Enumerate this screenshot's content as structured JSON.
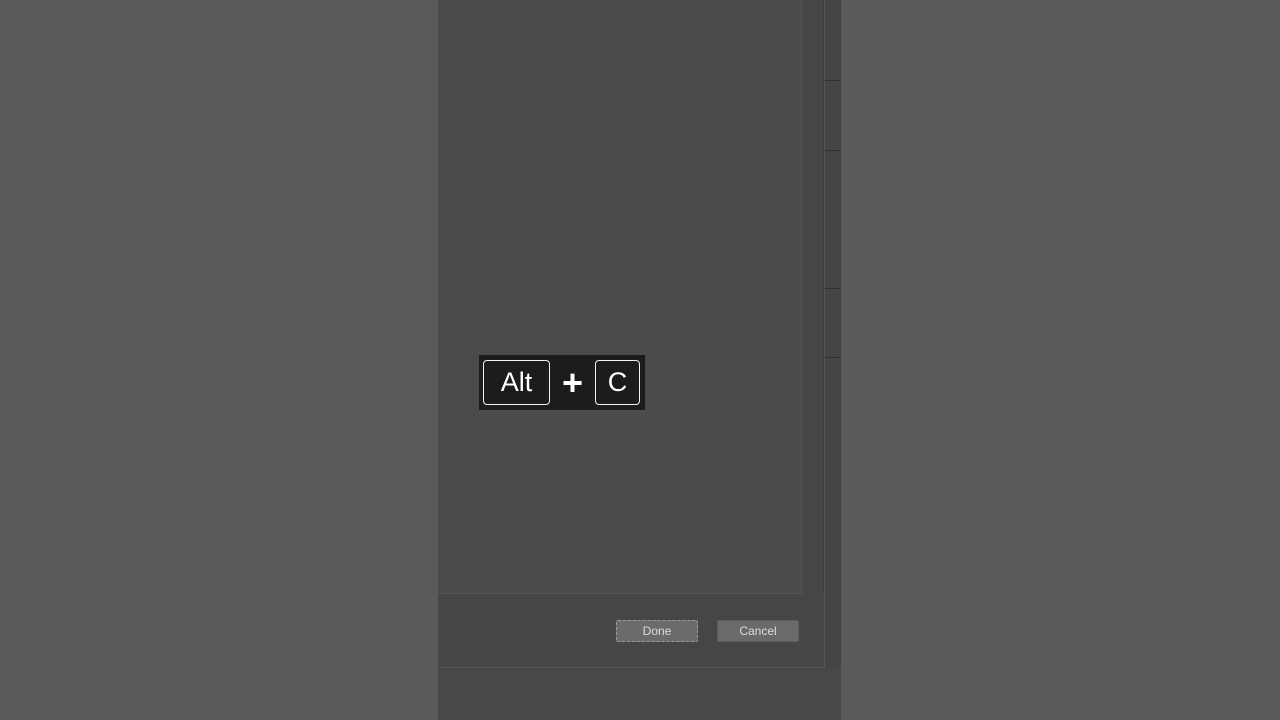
{
  "dialog": {
    "done_label": "Done",
    "cancel_label": "Cancel"
  },
  "shortcut": {
    "key1": "Alt",
    "separator": "+",
    "key2": "C"
  },
  "colors": {
    "background": "#5b5b5b",
    "dialog": "#464646",
    "overlay": "#1c1c1c",
    "key_border": "#f2f2f2"
  }
}
